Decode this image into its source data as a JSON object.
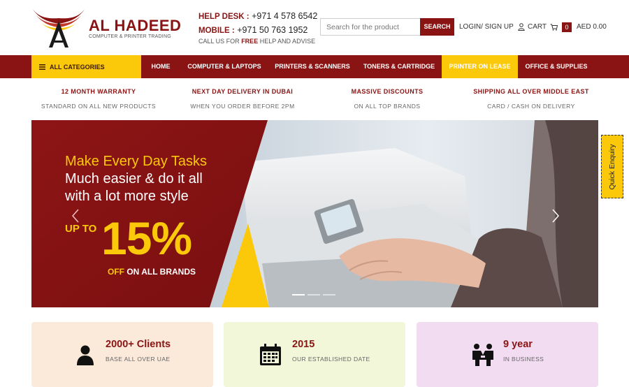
{
  "brand": {
    "name": "AL HADEED",
    "tagline": "COMPUTER & PRINTER TRADING",
    "colors": {
      "primary": "#8a1414",
      "accent": "#fbc80a"
    }
  },
  "contact": {
    "helpdesk_label": "HELP DESK :",
    "helpdesk_number": "+971 4 578 6542",
    "mobile_label": "MOBILE :",
    "mobile_number": "+971 50 763 1952",
    "note_prefix": "CALL US FOR ",
    "note_free": "FREE",
    "note_suffix": " HELP AND ADVISE"
  },
  "search": {
    "placeholder": "Search for the product",
    "button": "SEARCH"
  },
  "account": {
    "login_label": "LOGIN/ SIGN UP",
    "icon": "user-icon"
  },
  "cart": {
    "label": "CART",
    "count": "0",
    "total": "AED 0.00",
    "icon": "cart-icon"
  },
  "nav": {
    "all_categories": "ALL CATEGORIES",
    "items": [
      {
        "label": "HOME"
      },
      {
        "label": "COMPUTER & LAPTOPS"
      },
      {
        "label": "PRINTERS & SCANNERS"
      },
      {
        "label": "TONERS & CARTRIDGE"
      },
      {
        "label": "PRINTER ON LEASE",
        "active": true
      },
      {
        "label": "OFFICE & SUPPLIES"
      }
    ]
  },
  "features": [
    {
      "title": "12 MONTH WARRANTY",
      "subtitle": "STANDARD ON ALL NEW PRODUCTS"
    },
    {
      "title": "NEXT DAY DELIVERY IN DUBAI",
      "subtitle": "WHEN YOU ORDER BEFORE 2PM"
    },
    {
      "title": "MASSIVE DISCOUNTS",
      "subtitle": "ON ALL TOP BRANDS"
    },
    {
      "title": "SHIPPING ALL OVER MIDDLE EAST",
      "subtitle": "CARD / CASH ON DELIVERY"
    }
  ],
  "slider": {
    "headline1": "Make Every Day Tasks",
    "headline2": "Much easier & do it all",
    "headline3": "with a lot more style",
    "up_to": "UP TO",
    "percent": "15%",
    "off_word": "OFF",
    "off_rest": " ON ALL BRANDS",
    "slide_count": 3,
    "active_slide": 1
  },
  "quick_enquiry": "Quick Enquiry",
  "stats": [
    {
      "value": "2000+ Clients",
      "desc": "BASE ALL OVER UAE",
      "icon": "person-icon",
      "bg": "#fbe9da"
    },
    {
      "value": "2015",
      "desc": "OUR ESTABLISHED DATE",
      "icon": "calendar-icon",
      "bg": "#f1f7d8"
    },
    {
      "value": "9 year",
      "desc": "IN BUSINESS",
      "icon": "handshake-icon",
      "bg": "#f2dcf2"
    }
  ]
}
